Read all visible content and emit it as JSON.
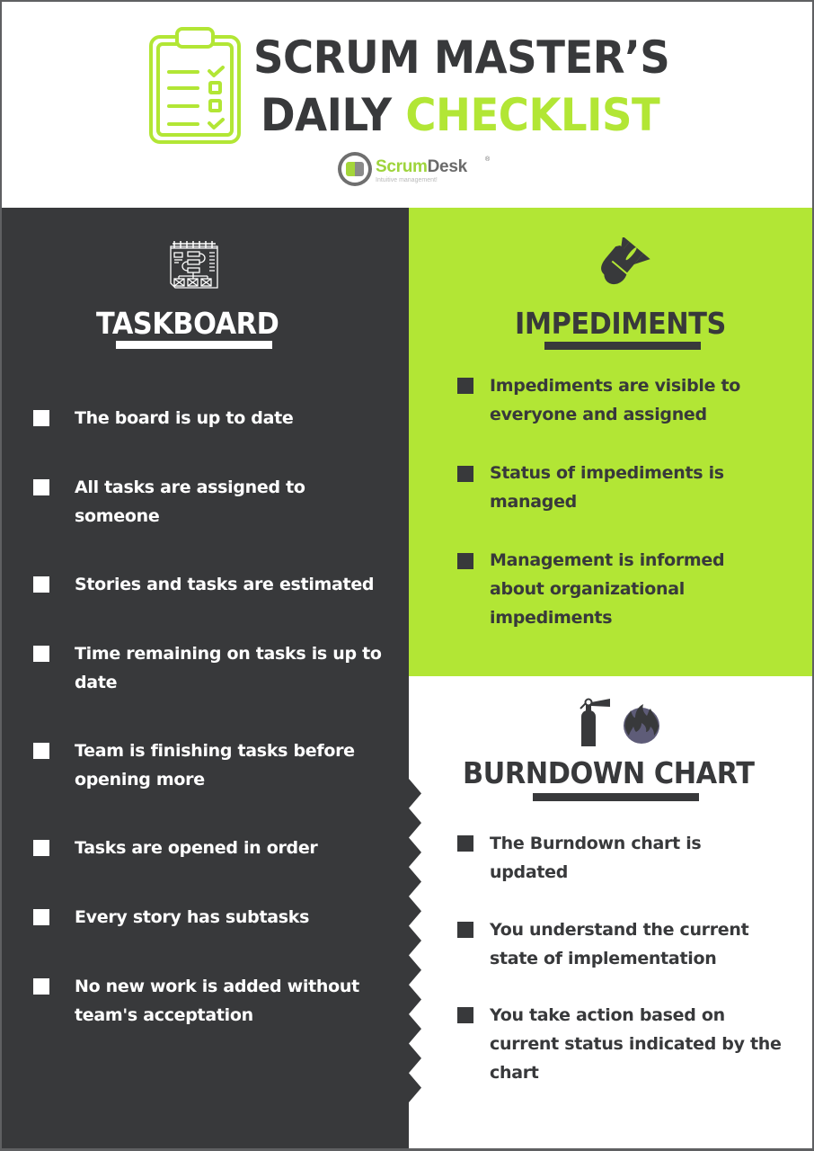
{
  "header": {
    "title_line1": "SCRUM MASTER’S",
    "title_line2_plain": "DAILY",
    "title_line2_accent": "CHECKLIST",
    "icon": "clipboard-checklist-icon"
  },
  "logo": {
    "name_part1": "Scrum",
    "name_part2": "Desk",
    "registered": "®",
    "tagline": "Intuitive management!"
  },
  "colors": {
    "dark": "#38393b",
    "accent_green": "#b2e635",
    "white": "#ffffff",
    "fire_purple": "#5e5c78"
  },
  "taskboard": {
    "title": "TASKBOARD",
    "icon": "taskboard-flowchart-icon",
    "items": [
      "The board is up to date",
      "All tasks are assigned to someone",
      "Stories and tasks are estimated",
      "Time remaining on tasks is up to date",
      "Team is finishing tasks before opening more",
      "Tasks are opened in order",
      "Every story has subtasks",
      "No new work is added without team's acceptation"
    ]
  },
  "impediments": {
    "title": "IMPEDIMENTS",
    "icon": "bomb-icon",
    "items": [
      "Impediments are visible to everyone and assigned",
      "Status of impediments is managed",
      "Management is informed about organizational impediments"
    ]
  },
  "burndown": {
    "title": "BURNDOWN CHART",
    "icons": [
      "fire-extinguisher-icon",
      "fire-icon"
    ],
    "items": [
      "The Burndown chart is updated",
      "You understand the current state of implementation",
      "You take action based on current status indicated by the chart"
    ]
  }
}
